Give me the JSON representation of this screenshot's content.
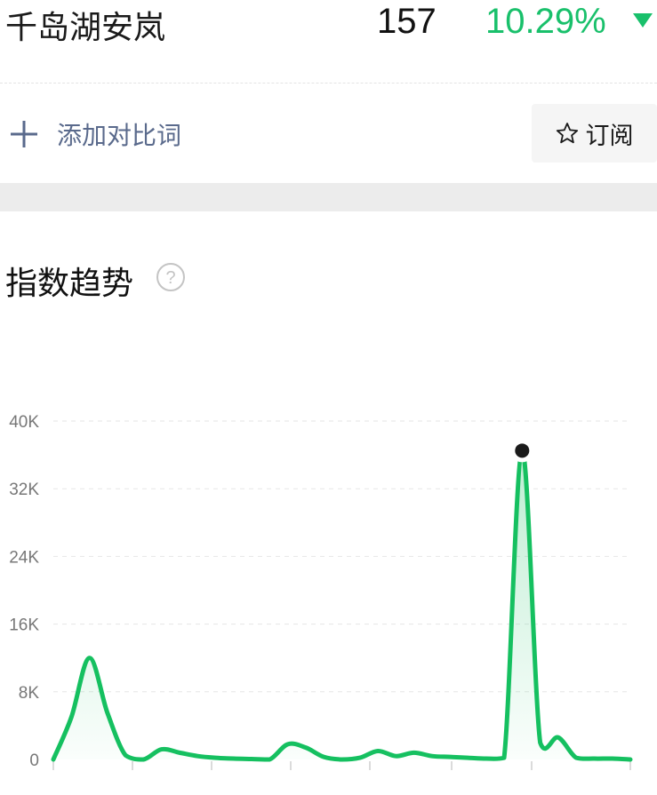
{
  "header": {
    "keyword": "千岛湖安岚",
    "value": "157",
    "change": "10.29%",
    "change_color": "#19c06b",
    "change_direction": "down"
  },
  "actions": {
    "add_compare_label": "添加对比词",
    "subscribe_label": "订阅"
  },
  "section": {
    "title": "指数趋势"
  },
  "chart_data": {
    "type": "area",
    "line_color": "#15c060",
    "y_ticks": [
      "40K",
      "32K",
      "24K",
      "16K",
      "8K",
      "0"
    ],
    "ylim": [
      0,
      40000
    ],
    "grid": true,
    "points": [
      {
        "x": 0,
        "y": 0
      },
      {
        "x": 1,
        "y": 5000
      },
      {
        "x": 2,
        "y": 12000
      },
      {
        "x": 3,
        "y": 5500
      },
      {
        "x": 4,
        "y": 500
      },
      {
        "x": 5,
        "y": 0
      },
      {
        "x": 6,
        "y": 1200
      },
      {
        "x": 7,
        "y": 800
      },
      {
        "x": 8,
        "y": 400
      },
      {
        "x": 9,
        "y": 200
      },
      {
        "x": 10,
        "y": 100
      },
      {
        "x": 11,
        "y": 50
      },
      {
        "x": 12,
        "y": 0
      },
      {
        "x": 13,
        "y": 1800
      },
      {
        "x": 14,
        "y": 1400
      },
      {
        "x": 15,
        "y": 300
      },
      {
        "x": 16,
        "y": 0
      },
      {
        "x": 17,
        "y": 200
      },
      {
        "x": 18,
        "y": 1000
      },
      {
        "x": 19,
        "y": 400
      },
      {
        "x": 20,
        "y": 800
      },
      {
        "x": 21,
        "y": 400
      },
      {
        "x": 22,
        "y": 300
      },
      {
        "x": 23,
        "y": 200
      },
      {
        "x": 24,
        "y": 100
      },
      {
        "x": 25,
        "y": 200
      },
      {
        "x": 26,
        "y": 36500
      },
      {
        "x": 27,
        "y": 2000
      },
      {
        "x": 28,
        "y": 2600
      },
      {
        "x": 29,
        "y": 200
      },
      {
        "x": 30,
        "y": 100
      },
      {
        "x": 31,
        "y": 100
      },
      {
        "x": 32,
        "y": 0
      }
    ],
    "highlight_index": 26
  }
}
